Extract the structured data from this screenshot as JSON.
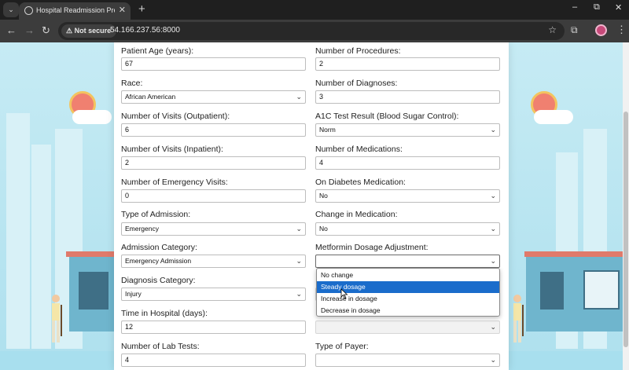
{
  "browser": {
    "tab_title": "Hospital Readmission Prediction",
    "security_label": "Not secure",
    "url": "54.166.237.56:8000"
  },
  "form": {
    "fields": [
      {
        "label": "Patient Age (years):",
        "value": "67",
        "type": "input"
      },
      {
        "label": "Number of Procedures:",
        "value": "2",
        "type": "input"
      },
      {
        "label": "Race:",
        "value": "African American",
        "type": "select"
      },
      {
        "label": "Number of Diagnoses:",
        "value": "3",
        "type": "input"
      },
      {
        "label": "Number of Visits (Outpatient):",
        "value": "6",
        "type": "input"
      },
      {
        "label": "A1C Test Result (Blood Sugar Control):",
        "value": "Norm",
        "type": "select"
      },
      {
        "label": "Number of Visits (Inpatient):",
        "value": "2",
        "type": "input"
      },
      {
        "label": "Number of Medications:",
        "value": "4",
        "type": "input"
      },
      {
        "label": "Number of Emergency Visits:",
        "value": "0",
        "type": "input"
      },
      {
        "label": "On Diabetes Medication:",
        "value": "No",
        "type": "select"
      },
      {
        "label": "Type of Admission:",
        "value": "Emergency",
        "type": "select"
      },
      {
        "label": "Change in Medication:",
        "value": "No",
        "type": "select"
      },
      {
        "label": "Admission Category:",
        "value": "Emergency Admission",
        "type": "select"
      },
      {
        "label": "Metformin Dosage Adjustment:",
        "value": "",
        "type": "select"
      },
      {
        "label": "Diagnosis Category:",
        "value": "Injury",
        "type": "select"
      },
      {
        "label": "Time in Hospital (days):",
        "value": "12",
        "type": "input"
      },
      {
        "label": "Number of Lab Tests:",
        "value": "4",
        "type": "input"
      },
      {
        "label": "Type of Payer:",
        "value": "",
        "type": "select"
      }
    ],
    "metformin_dropdown": {
      "options": [
        "No change",
        "Steady dosage",
        "Increase in dosage",
        "Decrease in dosage"
      ],
      "highlighted": "Steady dosage"
    }
  },
  "icons": {
    "tab_menu": "chevron-down-icon",
    "favicon": "globe-icon",
    "tab_close": "close-icon",
    "new_tab": "plus-icon",
    "back": "arrow-left-icon",
    "forward": "arrow-right-icon",
    "reload": "reload-icon",
    "warning": "warning-icon",
    "bookmark": "star-icon",
    "extensions": "puzzle-icon",
    "menu": "kebab-icon"
  },
  "colors": {
    "highlight": "#1a6ccb",
    "sky": "#c9ecf4",
    "browser_dark": "#1f1f1f"
  }
}
